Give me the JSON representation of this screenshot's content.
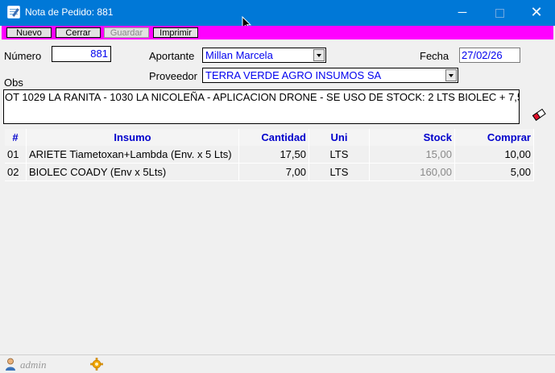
{
  "window": {
    "title": "Nota de Pedido: 881",
    "minimize_glyph": "─",
    "close_glyph": "✕"
  },
  "toolbar": {
    "nuevo": "Nuevo",
    "cerrar": "Cerrar",
    "guardar": "Guardar",
    "imprimir": "Imprimir"
  },
  "form": {
    "numero_label": "Número",
    "numero_value": "881",
    "aportante_label": "Aportante",
    "aportante_value": "Millan Marcela",
    "fecha_label": "Fecha",
    "fecha_value": "27/02/26",
    "proveedor_label": "Proveedor",
    "proveedor_value": "TERRA VERDE AGRO INSUMOS SA",
    "obs_label": "Obs",
    "obs_value": "OT 1029 LA RANITA - 1030 LA NICOLEÑA  - APLICACION DRONE - SE USO DE STOCK: 2 LTS BIOLEC + 7,5"
  },
  "table": {
    "headers": {
      "num": "#",
      "insumo": "Insumo",
      "cantidad": "Cantidad",
      "uni": "Uni",
      "stock": "Stock",
      "comprar": "Comprar"
    },
    "rows": [
      {
        "num": "01",
        "insumo": "ARIETE Tiametoxan+Lambda (Env. x 5 Lts)",
        "cantidad": "17,50",
        "uni": "LTS",
        "stock": "15,00",
        "comprar": "10,00"
      },
      {
        "num": "02",
        "insumo": "BIOLEC COADY (Env x 5Lts)",
        "cantidad": "7,00",
        "uni": "LTS",
        "stock": "160,00",
        "comprar": "5,00"
      }
    ]
  },
  "status": {
    "user": "admin"
  },
  "icons": {
    "app": "form-icon",
    "eraser": "eraser-icon",
    "user": "user-icon",
    "settings": "gear-icon"
  },
  "colors": {
    "titlebar": "#0078d7",
    "toolbar": "#ff00ff",
    "value_text": "#0000ee",
    "header_text": "#0000cc"
  }
}
